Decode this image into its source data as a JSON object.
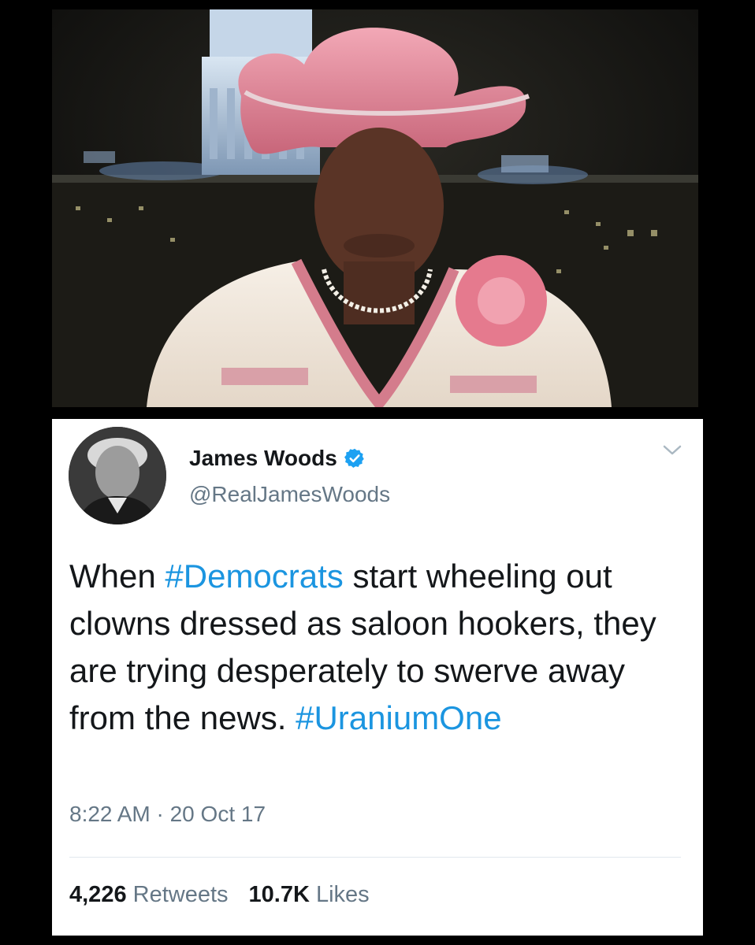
{
  "tweet": {
    "display_name": "James Woods",
    "handle": "@RealJamesWoods",
    "text_parts": [
      {
        "text": "When ",
        "type": "text"
      },
      {
        "text": "#Democrats",
        "type": "hashtag"
      },
      {
        "text": " start wheeling out clowns dressed as saloon hookers,  they are trying desperately to swerve away from the news. ",
        "type": "text"
      },
      {
        "text": "#UraniumOne",
        "type": "hashtag"
      }
    ],
    "timestamp": "8:22 AM · 20 Oct 17",
    "retweets_count": "4,226",
    "retweets_label": "Retweets",
    "likes_count": "10.7K",
    "likes_label": "Likes"
  },
  "icons": {
    "verified": "verified-badge-icon",
    "menu": "chevron-down-icon"
  },
  "colors": {
    "background": "#000000",
    "card": "#ffffff",
    "hashtag": "#1b95e0",
    "verified": "#1da1f2",
    "secondary_text": "#657786",
    "primary_text": "#14171a"
  }
}
